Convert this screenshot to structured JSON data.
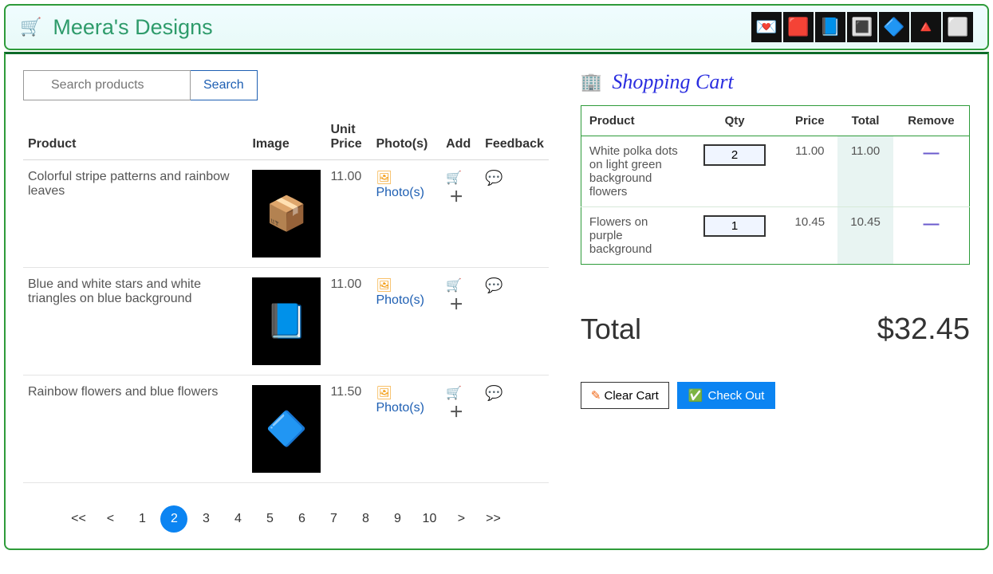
{
  "header": {
    "brand": "Meera's Designs",
    "thumbs": [
      "💌",
      "🟥",
      "📘",
      "🔳",
      "🔷",
      "🔺",
      "⬜"
    ]
  },
  "search": {
    "placeholder": "Search products",
    "button": "Search"
  },
  "products": {
    "columns": {
      "product": "Product",
      "image": "Image",
      "unit_price": "Unit Price",
      "photos": "Photo(s)",
      "add": "Add",
      "feedback": "Feedback"
    },
    "photos_label": "Photo(s)",
    "rows": [
      {
        "name": "Colorful stripe patterns and rainbow leaves",
        "price": "11.00",
        "thumb": "📦"
      },
      {
        "name": "Blue and white stars and white triangles on blue background",
        "price": "11.00",
        "thumb": "📘"
      },
      {
        "name": "Rainbow flowers and blue flowers",
        "price": "11.50",
        "thumb": "🔷"
      }
    ]
  },
  "pager": {
    "first": "<<",
    "prev": "<",
    "pages": [
      "1",
      "2",
      "3",
      "4",
      "5",
      "6",
      "7",
      "8",
      "9",
      "10"
    ],
    "current": "2",
    "next": ">",
    "last": ">>"
  },
  "cart": {
    "title": "Shopping Cart",
    "columns": {
      "product": "Product",
      "qty": "Qty",
      "price": "Price",
      "total": "Total",
      "remove": "Remove"
    },
    "items": [
      {
        "name": "White polka dots on light green background flowers",
        "qty": "2",
        "price": "11.00",
        "total": "11.00"
      },
      {
        "name": "Flowers on purple background",
        "qty": "1",
        "price": "10.45",
        "total": "10.45"
      }
    ],
    "total_label": "Total",
    "total_value": "$32.45",
    "clear_label": "Clear Cart",
    "checkout_label": "Check Out"
  }
}
